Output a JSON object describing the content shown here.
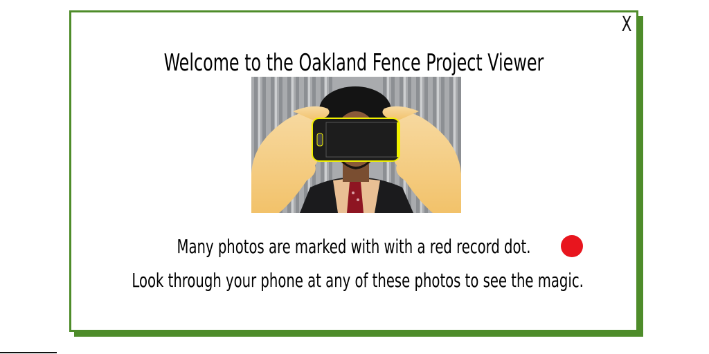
{
  "dialog": {
    "close_label": "X",
    "title": "Welcome to the Oakland Fence Project Viewer",
    "message_line1": "Many photos are marked with with a red record dot.",
    "message_line2": "Look through your phone at any of these photos to see the magic.",
    "record_dot_icon": "red-record-dot-icon",
    "hero_image": "hands-holding-phone-over-portrait-illustration"
  },
  "colors": {
    "border": "#4e8c2a",
    "record_dot": "#e8151e",
    "phone_outline": "#f2f200"
  }
}
